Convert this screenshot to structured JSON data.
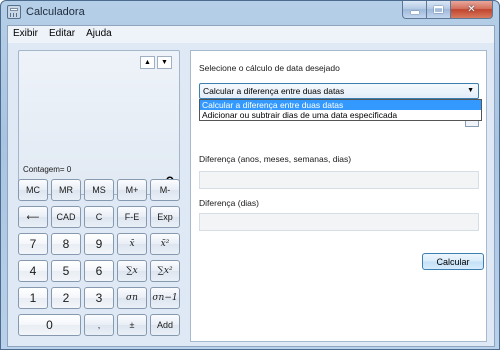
{
  "window": {
    "title": "Calculadora"
  },
  "menu": [
    "Exibir",
    "Editar",
    "Ajuda"
  ],
  "display": {
    "memory_count": "Contagem= 0",
    "value": "0"
  },
  "keypad": [
    [
      "MC",
      "MR",
      "MS",
      "M+",
      "M-"
    ],
    [
      "⟵",
      "CAD",
      "C",
      "F-E",
      "Exp"
    ],
    [
      "7",
      "8",
      "9",
      "x̄",
      "x̄²"
    ],
    [
      "4",
      "5",
      "6",
      "∑x",
      "∑x²"
    ],
    [
      "1",
      "2",
      "3",
      "σn",
      "σn−1"
    ],
    [
      "0",
      ",",
      "±",
      "Add"
    ]
  ],
  "date_panel": {
    "select_label": "Selecione o cálculo de data desejado",
    "selected_value": "Calcular a diferença entre duas datas",
    "options": [
      "Calcular a diferença entre duas datas",
      "Adicionar ou subtrair dias de uma data especificada"
    ],
    "diff_label_1": "Diferença (anos, meses, semanas, dias)",
    "diff_label_2": "Diferença (dias)",
    "calculate_label": "Calcular"
  }
}
